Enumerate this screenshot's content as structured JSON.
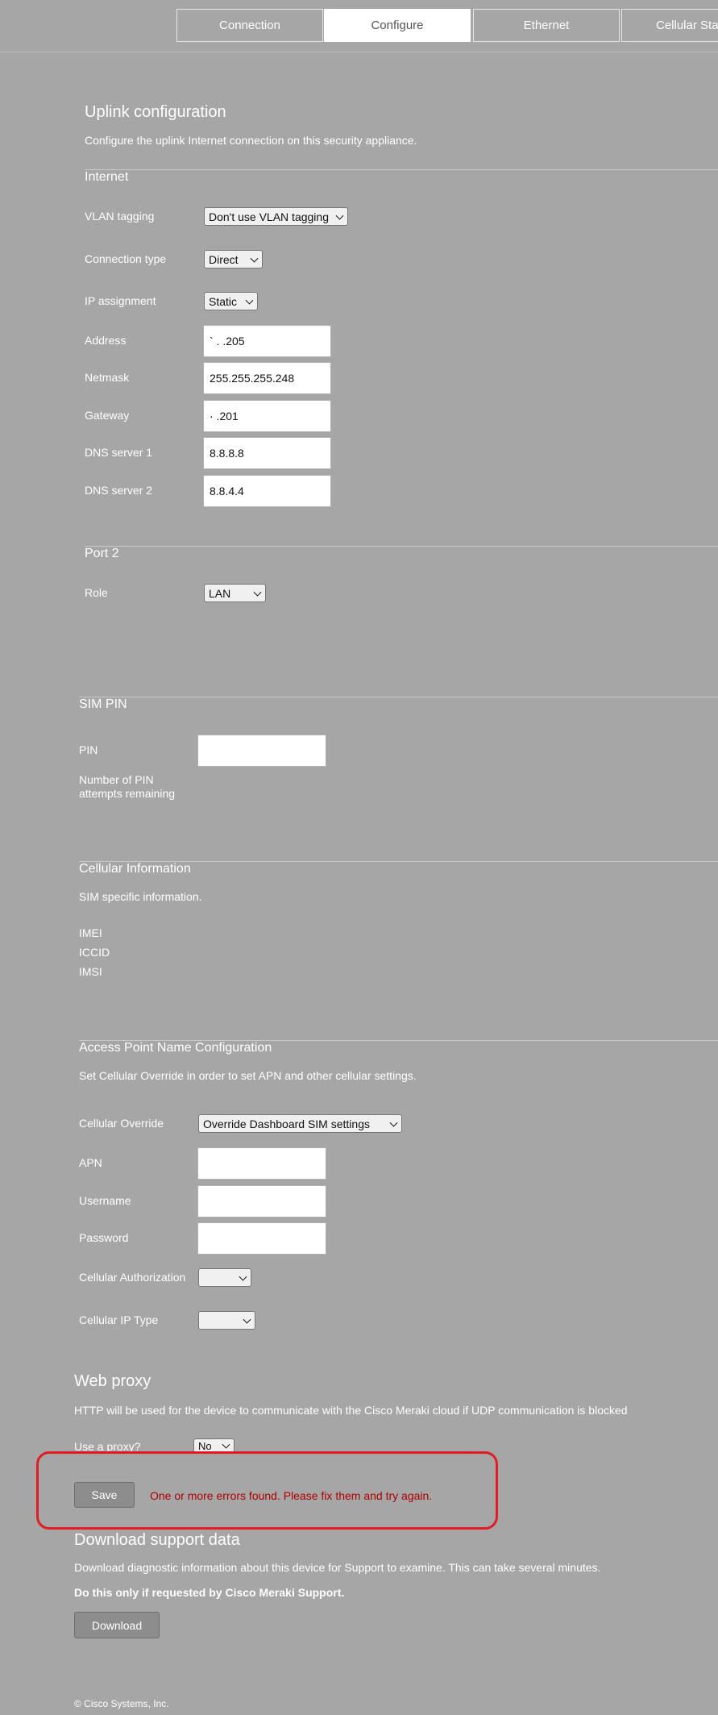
{
  "tabs": [
    {
      "label": "Connection",
      "active": false
    },
    {
      "label": "Configure",
      "active": true
    },
    {
      "label": "Ethernet",
      "active": false
    },
    {
      "label": "Cellular Stat",
      "active": false
    }
  ],
  "uplink": {
    "title": "Uplink configuration",
    "description": "Configure the uplink Internet connection on this security appliance.",
    "internet_heading": "Internet",
    "vlan_label": "VLAN tagging",
    "vlan_value": "Don't use VLAN tagging",
    "conn_type_label": "Connection type",
    "conn_type_value": "Direct",
    "ip_assign_label": "IP assignment",
    "ip_assign_value": "Static",
    "address_label": "Address",
    "address_value": "` . .205",
    "netmask_label": "Netmask",
    "netmask_value": "255.255.255.248",
    "gateway_label": "Gateway",
    "gateway_value": "· .201",
    "dns1_label": "DNS server 1",
    "dns1_value": "8.8.8.8",
    "dns2_label": "DNS server 2",
    "dns2_value": "8.8.4.4",
    "port2_heading": "Port 2",
    "role_label": "Role",
    "role_value": "LAN"
  },
  "sim": {
    "heading": "SIM PIN",
    "pin_label": "PIN",
    "pin_value": "",
    "attempts_label_line1": "Number of PIN",
    "attempts_label_line2": "attempts remaining"
  },
  "cellular_info": {
    "heading": "Cellular Information",
    "description": "SIM specific information.",
    "imei_label": "IMEI",
    "iccid_label": "ICCID",
    "imsi_label": "IMSI"
  },
  "apn": {
    "heading": "Access Point Name Configuration",
    "description": "Set Cellular Override in order to set APN and other cellular settings.",
    "override_label": "Cellular Override",
    "override_value": "Override Dashboard SIM settings",
    "apn_label": "APN",
    "apn_value": "",
    "username_label": "Username",
    "username_value": "",
    "password_label": "Password",
    "password_value": "",
    "auth_label": "Cellular Authorization",
    "auth_value": "",
    "iptype_label": "Cellular IP Type",
    "iptype_value": ""
  },
  "web_proxy": {
    "title": "Web proxy",
    "description": "HTTP will be used for the device to communicate with the Cisco Meraki cloud if UDP communication is blocked",
    "use_proxy_label": "Use a proxy?",
    "use_proxy_value": "No"
  },
  "save": {
    "button_label": "Save",
    "error_text": "One or more errors found. Please fix them and try again.",
    "error_color": "#b00000",
    "highlight_color": "#e31c24"
  },
  "support": {
    "title": "Download support data",
    "description": "Download diagnostic information about this device for Support to examine. This can take several minutes.",
    "warning": "Do this only if requested by Cisco Meraki Support.",
    "download_label": "Download"
  },
  "footer": {
    "copyright": "© Cisco Systems, Inc."
  }
}
